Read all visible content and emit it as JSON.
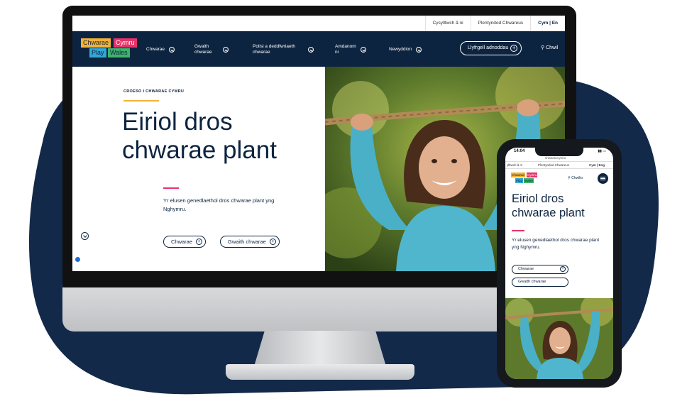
{
  "colors": {
    "navy": "#0d2440",
    "yellow": "#f4b234",
    "pink": "#e8336a",
    "blue": "#2fa8d8",
    "green": "#3fb36b"
  },
  "desktop": {
    "util_bar": [
      "Cysylltwch â ni",
      "Plentyndod Chwareus",
      "Cym | En"
    ],
    "logo": {
      "word1": "Chwarae",
      "word2": "Cymru",
      "word3": "Play",
      "word4": "Wales"
    },
    "nav": [
      {
        "label": "Chwarae",
        "icon": "chevron-down-icon"
      },
      {
        "label": "Gwaith chwarae",
        "icon": "chevron-down-icon"
      },
      {
        "label": "Polisi a deddfwriaeth chwarae",
        "icon": "chevron-down-icon"
      },
      {
        "label": "Amdanom ni",
        "icon": "chevron-down-icon"
      },
      {
        "label": "Newyddion",
        "icon": "chevron-down-icon"
      }
    ],
    "resource_button": "Llyfrgell adnoddau",
    "search_label": "Chwil",
    "hero": {
      "kicker": "CROESO I CHWARAE CYMRU",
      "title": "Eiriol dros chwarae plant",
      "subtitle": "Yr elusen genedlaethol dros chwarae plant yng Nghymru.",
      "cta_primary": "Chwarae",
      "cta_secondary": "Gwaith chwarae"
    }
  },
  "mobile": {
    "time": "14:04",
    "url": "chwaraecymru",
    "util_bar": [
      "ylltwch â ni",
      "Plentyndod Chwareus",
      "Cym | Eng"
    ],
    "logo": {
      "word1": "Chwarae",
      "word2": "Cymru",
      "word3": "Play",
      "word4": "Wales"
    },
    "search_label": "Chwilio",
    "hero": {
      "title": "Eiriol dros chwarae plant",
      "subtitle": "Yr elusen genedlaethol dros chwarae plant yng Nghymru.",
      "cta_primary": "Chwarae",
      "cta_secondary": "Gwaith chwarae"
    }
  }
}
